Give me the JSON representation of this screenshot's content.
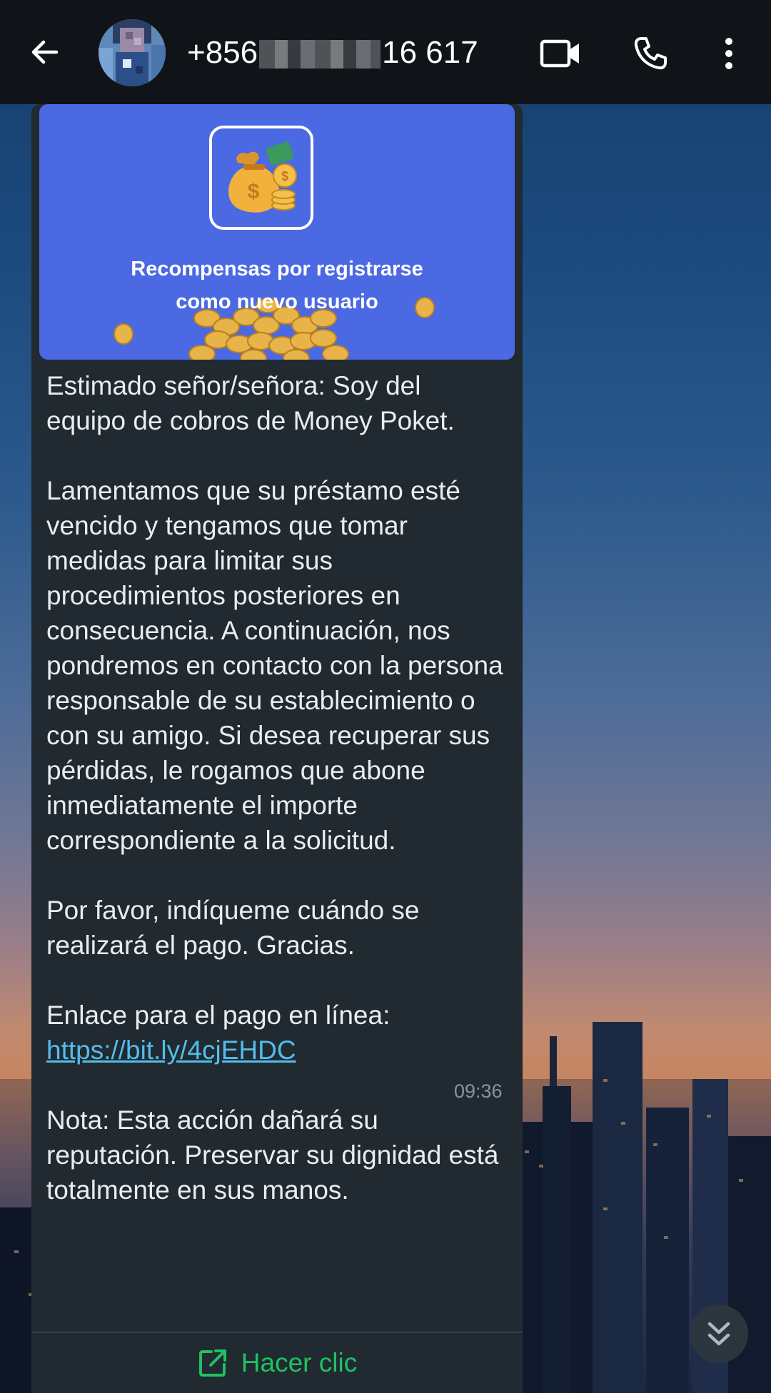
{
  "header": {
    "contact_prefix": "+856",
    "contact_suffix": "16 617",
    "back_icon": "arrow-left-icon",
    "video_icon": "video-camera-icon",
    "call_icon": "phone-icon",
    "more_icon": "more-vertical-icon"
  },
  "message": {
    "image_caption_line1": "Recompensas por registrarse",
    "image_caption_line2": "como nuevo usuario",
    "paragraphs": [
      "Estimado señor/señora: Soy del equipo de cobros de Money Poket.",
      "Lamentamos que su préstamo esté vencido y tengamos que tomar medidas para limitar sus procedimientos posteriores en consecuencia. A continuación, nos pondremos en contacto con la persona responsable de su establecimiento o con su amigo. Si desea recuperar sus pérdidas, le rogamos que abone inmediatamente el importe correspondiente a la solicitud.",
      "Por favor, indíqueme cuándo se realizará el pago. Gracias."
    ],
    "link_intro": "Enlace para el pago en línea:",
    "link_text": "https://bit.ly/4cjEHDC",
    "note": "Nota: Esta acción dañará su reputación. Preservar su dignidad está totalmente en sus manos.",
    "time": "09:36",
    "action_label": "Hacer clic",
    "action_icon": "external-link-icon"
  },
  "colors": {
    "topbar": "#101418",
    "bubble": "#202a30",
    "link": "#53bdeb",
    "action": "#21c063",
    "promo_bg": "#4c69e4"
  },
  "scroll_icon": "double-chevron-down-icon"
}
